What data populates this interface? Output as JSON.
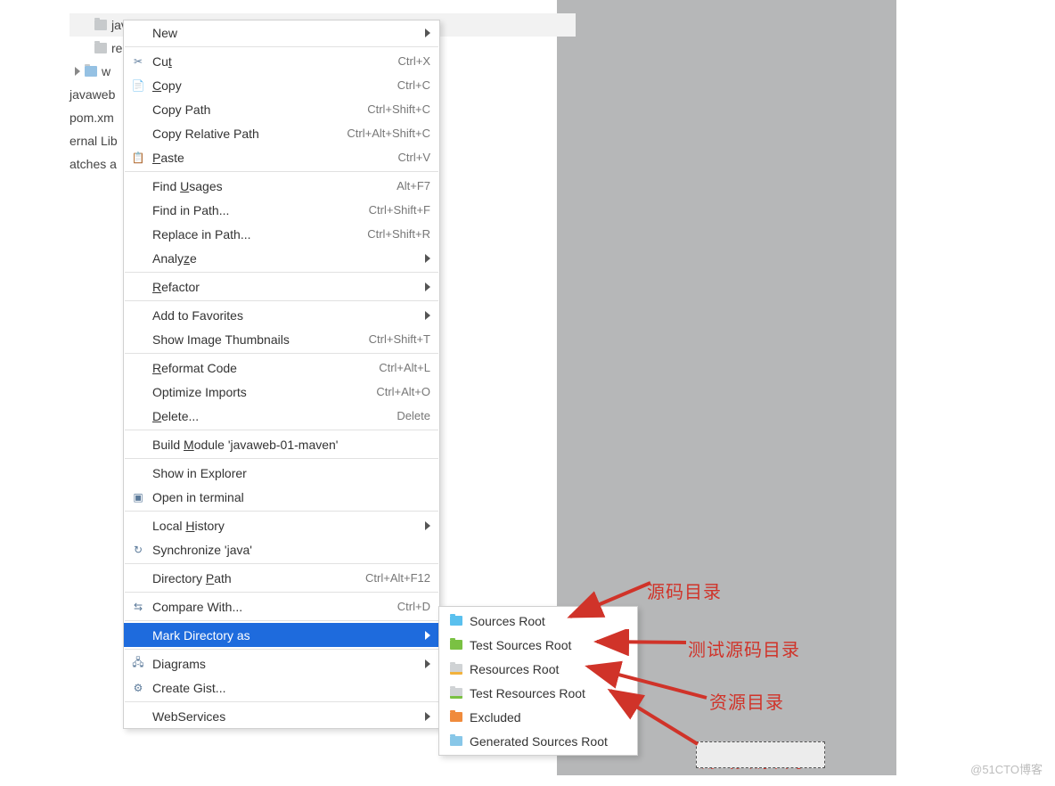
{
  "tree": {
    "items": [
      "java",
      "re",
      "w"
    ],
    "unders": [
      "javaweb",
      "pom.xm",
      "ernal Lib",
      "atches a"
    ]
  },
  "menu": [
    {
      "label": "New",
      "shortcut": "",
      "icon": "",
      "sub": true
    },
    {
      "sep": true
    },
    {
      "label": "Cut",
      "u": "t",
      "shortcut": "Ctrl+X",
      "icon": "✂"
    },
    {
      "label": "Copy",
      "u": "C",
      "shortcut": "Ctrl+C",
      "icon": "📄"
    },
    {
      "label": "Copy Path",
      "u": "",
      "shortcut": "Ctrl+Shift+C",
      "icon": ""
    },
    {
      "label": "Copy Relative Path",
      "u": "",
      "shortcut": "Ctrl+Alt+Shift+C",
      "icon": ""
    },
    {
      "label": "Paste",
      "u": "P",
      "shortcut": "Ctrl+V",
      "icon": "📋"
    },
    {
      "sep": true
    },
    {
      "label": "Find Usages",
      "u": "U",
      "shortcut": "Alt+F7",
      "icon": ""
    },
    {
      "label": "Find in Path...",
      "u": "",
      "shortcut": "Ctrl+Shift+F",
      "icon": ""
    },
    {
      "label": "Replace in Path...",
      "u": "",
      "shortcut": "Ctrl+Shift+R",
      "icon": ""
    },
    {
      "label": "Analyze",
      "u": "z",
      "shortcut": "",
      "icon": "",
      "sub": true
    },
    {
      "sep": true
    },
    {
      "label": "Refactor",
      "u": "R",
      "shortcut": "",
      "icon": "",
      "sub": true
    },
    {
      "sep": true
    },
    {
      "label": "Add to Favorites",
      "u": "",
      "shortcut": "",
      "icon": "",
      "sub": true
    },
    {
      "label": "Show Image Thumbnails",
      "u": "",
      "shortcut": "Ctrl+Shift+T",
      "icon": ""
    },
    {
      "sep": true
    },
    {
      "label": "Reformat Code",
      "u": "R",
      "shortcut": "Ctrl+Alt+L",
      "icon": ""
    },
    {
      "label": "Optimize Imports",
      "u": "",
      "shortcut": "Ctrl+Alt+O",
      "icon": ""
    },
    {
      "label": "Delete...",
      "u": "D",
      "shortcut": "Delete",
      "icon": ""
    },
    {
      "sep": true
    },
    {
      "label": "Build Module 'javaweb-01-maven'",
      "u": "M",
      "shortcut": "",
      "icon": ""
    },
    {
      "sep": true
    },
    {
      "label": "Show in Explorer",
      "u": "",
      "shortcut": "",
      "icon": ""
    },
    {
      "label": "Open in terminal",
      "u": "",
      "shortcut": "",
      "icon": "▣"
    },
    {
      "sep": true
    },
    {
      "label": "Local History",
      "u": "H",
      "shortcut": "",
      "icon": "",
      "sub": true
    },
    {
      "label": "Synchronize 'java'",
      "u": "",
      "shortcut": "",
      "icon": "↻"
    },
    {
      "sep": true
    },
    {
      "label": "Directory Path",
      "u": "P",
      "shortcut": "Ctrl+Alt+F12",
      "icon": ""
    },
    {
      "sep": true
    },
    {
      "label": "Compare With...",
      "u": "",
      "shortcut": "Ctrl+D",
      "icon": "⇆"
    },
    {
      "sep": true
    },
    {
      "label": "Mark Directory as",
      "u": "",
      "shortcut": "",
      "icon": "",
      "sub": true,
      "hl": true
    },
    {
      "sep": true
    },
    {
      "label": "Diagrams",
      "u": "",
      "shortcut": "",
      "icon": "🖧",
      "sub": true
    },
    {
      "label": "Create Gist...",
      "u": "",
      "shortcut": "",
      "icon": "⚙"
    },
    {
      "sep": true
    },
    {
      "label": "WebServices",
      "u": "",
      "shortcut": "",
      "icon": "",
      "sub": true
    }
  ],
  "submenu": [
    {
      "label": "Sources Root",
      "cls": "blue"
    },
    {
      "label": "Test Sources Root",
      "cls": "green"
    },
    {
      "label": "Resources Root",
      "cls": "grayres"
    },
    {
      "label": "Test Resources Root",
      "cls": "grayres2"
    },
    {
      "label": "Excluded",
      "cls": "orange"
    },
    {
      "label": "Generated Sources Root",
      "cls": "gen"
    }
  ],
  "annotations": {
    "a1": "源码目录",
    "a2": "测试源码目录",
    "a3": "资源目录",
    "a4": "测试资源目录"
  },
  "watermark": "@51CTO博客"
}
